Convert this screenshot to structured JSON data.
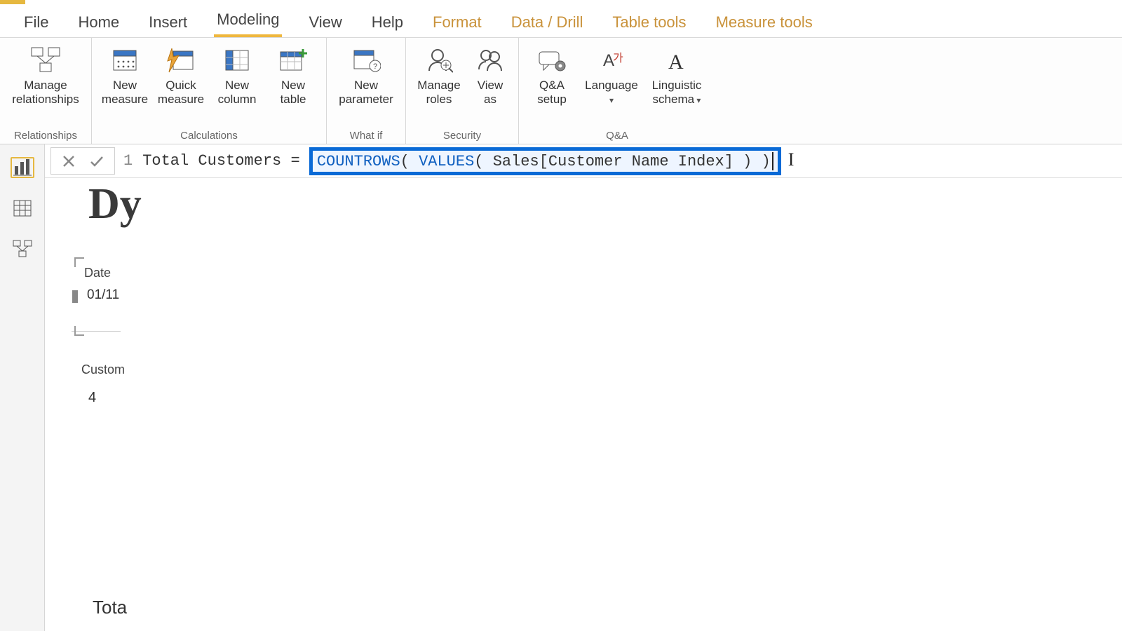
{
  "tabs": {
    "file": "File",
    "home": "Home",
    "insert": "Insert",
    "modeling": "Modeling",
    "view": "View",
    "help": "Help",
    "format": "Format",
    "data_drill": "Data / Drill",
    "table_tools": "Table tools",
    "measure_tools": "Measure tools"
  },
  "ribbon": {
    "relationships": {
      "manage": "Manage\nrelationships",
      "group_label": "Relationships"
    },
    "calculations": {
      "new_measure": "New\nmeasure",
      "quick_measure": "Quick\nmeasure",
      "new_column": "New\ncolumn",
      "new_table": "New\ntable",
      "group_label": "Calculations"
    },
    "whatif": {
      "new_parameter": "New\nparameter",
      "group_label": "What if"
    },
    "security": {
      "manage_roles": "Manage\nroles",
      "view_as": "View\nas",
      "group_label": "Security"
    },
    "qa": {
      "qa_setup": "Q&A\nsetup",
      "language": "Language",
      "linguistic_schema": "Linguistic\nschema",
      "group_label": "Q&A"
    }
  },
  "formula": {
    "line_no": "1",
    "measure_name": "Total Customers =",
    "fn1": "COUNTROWS",
    "paren1": "( ",
    "fn2": "VALUES",
    "paren2": "( ",
    "col_ref": "Sales[Customer Name Index]",
    "close": " ) )"
  },
  "canvas": {
    "title_fragment": "Dy",
    "slicer_header": "Date",
    "slicer_value": "01/11",
    "field_label": "Custom",
    "field_value": "4",
    "bottom_label": "Tota"
  }
}
